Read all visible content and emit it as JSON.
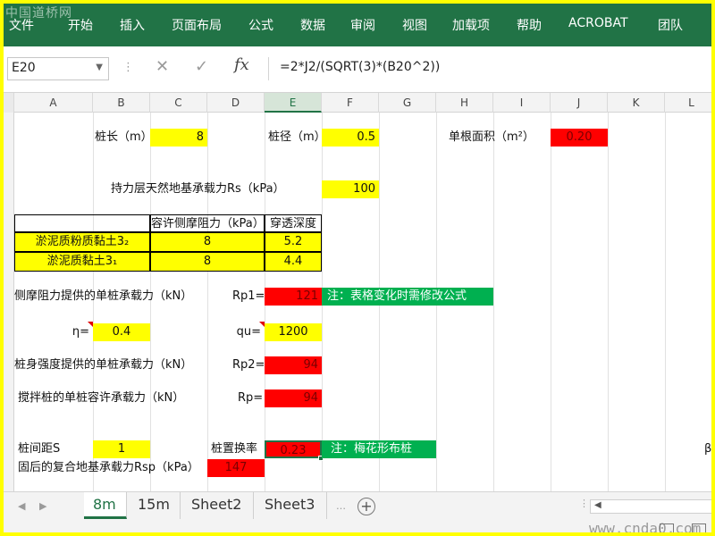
{
  "ribbon": {
    "watermark": "中国道桥网",
    "menu": [
      "文件",
      "开始",
      "插入",
      "页面布局",
      "公式",
      "数据",
      "审阅",
      "视图",
      "加载项",
      "帮助",
      "ACROBAT",
      "团队"
    ]
  },
  "formula_bar": {
    "name_box": "E20",
    "separator": "⋮",
    "cancel": "✕",
    "enter": "✓",
    "fx": "fx",
    "formula": "=2*J2/(SQRT(3)*(B20^2))"
  },
  "columns": [
    "A",
    "B",
    "C",
    "D",
    "E",
    "F",
    "G",
    "H",
    "I",
    "J",
    "K",
    "L"
  ],
  "active_column": "E",
  "cells": {
    "pile_length_label": "桩长（m）",
    "pile_length": "8",
    "pile_diameter_label": "桩径（m）",
    "pile_diameter": "0.5",
    "single_area_label": "单根面积（m²）",
    "single_area": "0.20",
    "bearing_rs_label": "持力层天然地基承载力Rs（kPa）",
    "bearing_rs": "100",
    "table_header_friction": "容许侧摩阻力（kPa）",
    "table_header_depth": "穿透深度",
    "soil1_name": "淤泥质粉质黏土3₂",
    "soil1_friction": "8",
    "soil1_depth": "5.2",
    "soil2_name": "淤泥质黏土3₁",
    "soil2_friction": "8",
    "soil2_depth": "4.4",
    "rp1_desc": "侧摩阻力提供的单桩承载力（kN）",
    "rp1_label": "Rp1=",
    "rp1_value": "121",
    "note_table": "注：表格变化时需修改公式",
    "eta_label": "η=",
    "eta_value": "0.4",
    "qu_label": "qu=",
    "qu_value": "1200",
    "rp2_desc": "桩身强度提供的单桩承载力（kN）",
    "rp2_label": "Rp2=",
    "rp2_value": "94",
    "rp_desc": "搅拌桩的单桩容许承载力（kN）",
    "rp_label": "Rp=",
    "rp_value": "94",
    "spacing_label": "桩间距S",
    "spacing_value": "1",
    "replace_label": "桩置换率",
    "replace_value": "0.23",
    "note_layout": "注：梅花形布桩",
    "beta_label": "β=",
    "rsp_label": "固后的复合地基承载力Rsp（kPa）",
    "rsp_value": "147"
  },
  "sheets": [
    "8m",
    "15m",
    "Sheet2",
    "Sheet3"
  ],
  "active_sheet": "8m",
  "status_watermark": "www.cnda0.com"
}
